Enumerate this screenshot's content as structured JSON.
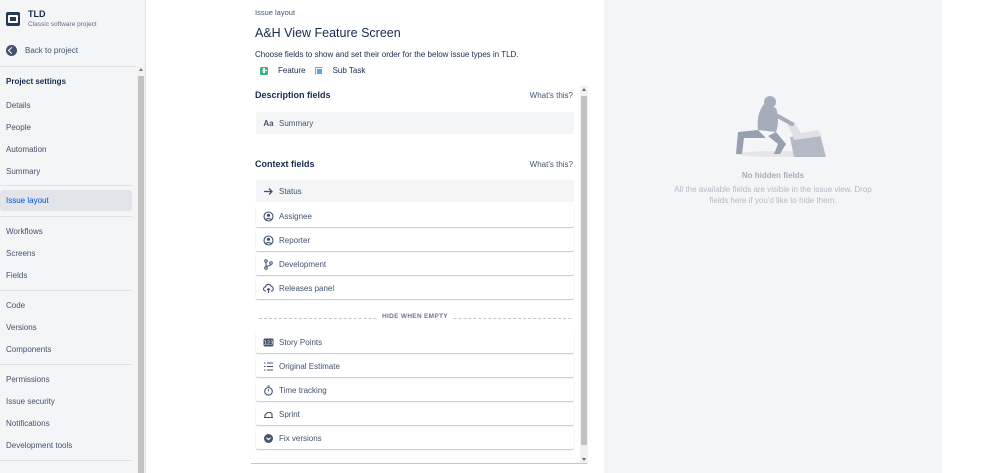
{
  "project": {
    "name": "TLD",
    "type": "Classic software project"
  },
  "back_link": "Back to project",
  "nav": {
    "heading": "Project settings",
    "groups": [
      [
        {
          "label": "Details"
        },
        {
          "label": "People"
        },
        {
          "label": "Automation"
        },
        {
          "label": "Summary"
        }
      ],
      [
        {
          "label": "Issue layout",
          "active": true
        }
      ],
      [
        {
          "label": "Workflows"
        },
        {
          "label": "Screens"
        },
        {
          "label": "Fields"
        }
      ],
      [
        {
          "label": "Code"
        },
        {
          "label": "Versions"
        },
        {
          "label": "Components"
        }
      ],
      [
        {
          "label": "Permissions"
        },
        {
          "label": "Issue security"
        },
        {
          "label": "Notifications"
        },
        {
          "label": "Development tools"
        }
      ]
    ]
  },
  "main": {
    "breadcrumb": "Issue layout",
    "title": "A&H View Feature Screen",
    "description": "Choose fields to show and set their order for the below issue types in TLD.",
    "issue_types": [
      {
        "label": "Feature",
        "icon": "feature-icon"
      },
      {
        "label": "Sub Task",
        "icon": "subtask-icon"
      }
    ],
    "description_section": {
      "title": "Description fields",
      "help": "What's this?",
      "fields": [
        {
          "label": "Summary",
          "icon": "text-icon"
        }
      ]
    },
    "context_section": {
      "title": "Context fields",
      "help": "What's this?",
      "fields": [
        {
          "label": "Status",
          "icon": "arrow-right-icon"
        },
        {
          "label": "Assignee",
          "icon": "user-icon"
        },
        {
          "label": "Reporter",
          "icon": "user-icon"
        },
        {
          "label": "Development",
          "icon": "branch-icon"
        },
        {
          "label": "Releases panel",
          "icon": "cloud-upload-icon"
        }
      ],
      "hide_when_empty_label": "HIDE WHEN EMPTY",
      "hidden_fields": [
        {
          "label": "Story Points",
          "icon": "number-icon"
        },
        {
          "label": "Original Estimate",
          "icon": "list-icon"
        },
        {
          "label": "Time tracking",
          "icon": "stopwatch-icon"
        },
        {
          "label": "Sprint",
          "icon": "sprint-icon"
        },
        {
          "label": "Fix versions",
          "icon": "chevron-circle-icon"
        }
      ]
    }
  },
  "hidden_panel": {
    "title": "No hidden fields",
    "text": "All the available fields are visible in the issue view. Drop fields here if you'd like to hide them."
  },
  "colors": {
    "accent": "#0052cc",
    "sidebar_bg": "#f4f5f7",
    "feature": "#36b37e",
    "subtask": "#4bade8"
  }
}
